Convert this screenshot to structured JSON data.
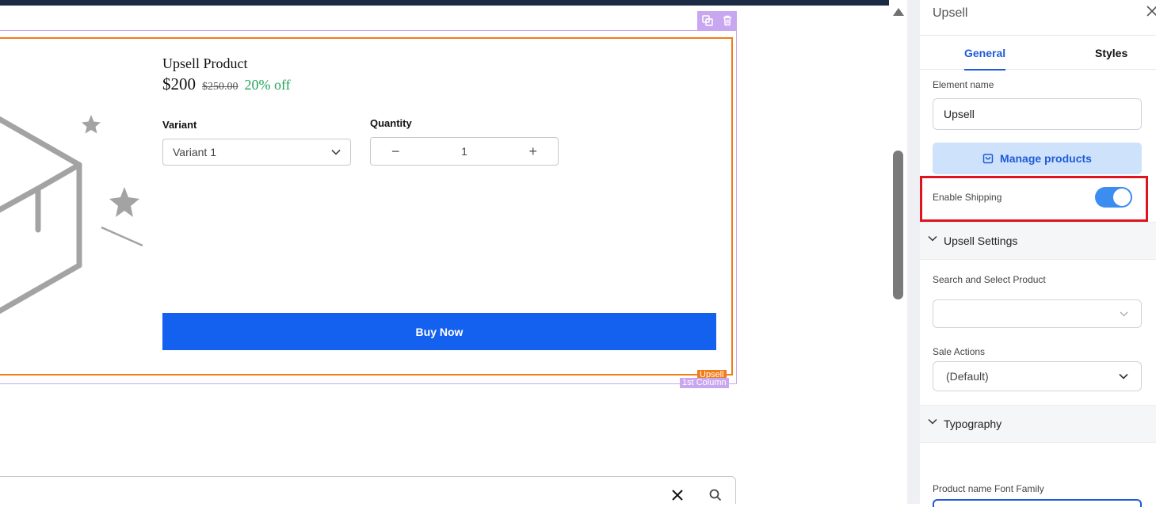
{
  "product": {
    "name": "Upsell Product",
    "price": "$200",
    "original_price": "$250.00",
    "discount": "20% off",
    "variant_label": "Variant",
    "variant_value": "Variant 1",
    "quantity_label": "Quantity",
    "quantity_minus": "−",
    "quantity_value": "1",
    "quantity_plus": "+",
    "buy_label": "Buy Now"
  },
  "builder": {
    "upsell_tag": "Upsell",
    "column_tag": "1st Column"
  },
  "panel": {
    "title": "Upsell",
    "tabs": [
      {
        "label": "General",
        "active": true
      },
      {
        "label": "Styles",
        "active": false
      }
    ],
    "element_name_label": "Element name",
    "element_name_value": "Upsell",
    "manage_products_label": "Manage products",
    "enable_shipping_label": "Enable Shipping",
    "enable_shipping_on": true,
    "sections": {
      "upsell_settings": "Upsell Settings",
      "typography": "Typography"
    },
    "search_select_label": "Search and Select Product",
    "search_select_value": "",
    "sale_actions_label": "Sale Actions",
    "sale_actions_value": "(Default)",
    "font_family_label": "Product name Font Family"
  },
  "colors": {
    "primary": "#1460ef",
    "accent_blue": "#1f5bd8",
    "upsell_outline": "#f07c1a",
    "column_outline": "#c9a7f0",
    "discount_green": "#22a45d",
    "highlight_red": "#e0141e"
  }
}
